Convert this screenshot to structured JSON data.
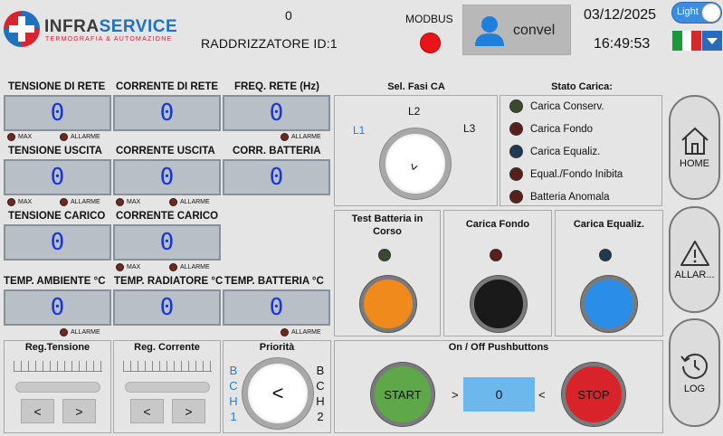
{
  "header": {
    "brand_part1": "INFRA",
    "brand_part2": "SERVICE",
    "tagline": "TERMOGRAFIA & AUTOMAZIONE",
    "counter": "0",
    "device_id": "RADDRIZZATORE ID:1",
    "modbus_label": "MODBUS",
    "user_name": "convel",
    "date": "03/12/2025",
    "time": "16:49:53",
    "theme_toggle": "Light",
    "language_flag": "italian-flag"
  },
  "meters": {
    "tensione_rete": {
      "label": "TENSIONE DI RETE",
      "value": "0"
    },
    "corrente_rete": {
      "label": "CORRENTE DI RETE",
      "value": "0"
    },
    "freq_rete": {
      "label": "FREQ. RETE (Hz)",
      "value": "0"
    },
    "tensione_uscita": {
      "label": "TENSIONE USCITA",
      "value": "0"
    },
    "corrente_uscita": {
      "label": "CORRENTE USCITA",
      "value": "0"
    },
    "corr_batteria": {
      "label": "CORR. BATTERIA",
      "value": "0"
    },
    "tensione_carico": {
      "label": "TENSIONE CARICO",
      "value": "0"
    },
    "corrente_carico": {
      "label": "CORRENTE CARICO",
      "value": "0"
    },
    "temp_ambiente": {
      "label": "TEMP. AMBIENTE °C",
      "value": "0"
    },
    "temp_radiatore": {
      "label": "TEMP. RADIATORE °C",
      "value": "0"
    },
    "temp_batteria": {
      "label": "TEMP. BATTERIA °C",
      "value": "0"
    }
  },
  "indicators": {
    "max": "MAX",
    "allarme": "ALLARME"
  },
  "sel_fasi": {
    "title": "Sel. Fasi CA",
    "l1": "L1",
    "l2": "L2",
    "l3": "L3",
    "knob_glyph": "^"
  },
  "stato_carica": {
    "title": "Stato Carica:",
    "items": [
      {
        "label": "Carica Conserv.",
        "color": "#3b4a2e"
      },
      {
        "label": "Carica Fondo",
        "color": "#5a1f1a"
      },
      {
        "label": "Carica Equaliz.",
        "color": "#1f3a52"
      },
      {
        "label": "Equal./Fondo Inibita",
        "color": "#5a1f1a"
      },
      {
        "label": "Batteria Anomala",
        "color": "#5a1f1a"
      }
    ]
  },
  "test_batteria": {
    "title": "Test Batteria in Corso",
    "led_color": "#3b4a2e",
    "button_color": "#f08a1c"
  },
  "carica_fondo": {
    "title": "Carica Fondo",
    "led_color": "#5a1f1a",
    "button_color": "#1a1a1a"
  },
  "carica_equaliz": {
    "title": "Carica Equaliz.",
    "led_color": "#1f3a52",
    "button_color": "#2a8ee8"
  },
  "reg_tensione": {
    "title": "Reg.Tensione",
    "left": "<",
    "right": ">"
  },
  "reg_corrente": {
    "title": "Reg. Corrente",
    "left": "<",
    "right": ">"
  },
  "priorita": {
    "title": "Priorità",
    "left_letters": [
      "B",
      "C",
      "H",
      "1"
    ],
    "right_letters": [
      "B",
      "C",
      "H",
      "2"
    ],
    "knob_glyph": "<"
  },
  "onoff": {
    "title": "On / Off Pushbuttons",
    "start": "START",
    "stop": "STOP",
    "value": "0",
    "gt": ">",
    "lt": "<"
  },
  "nav": {
    "home": "HOME",
    "alarms": "ALLAR...",
    "log": "LOG"
  }
}
